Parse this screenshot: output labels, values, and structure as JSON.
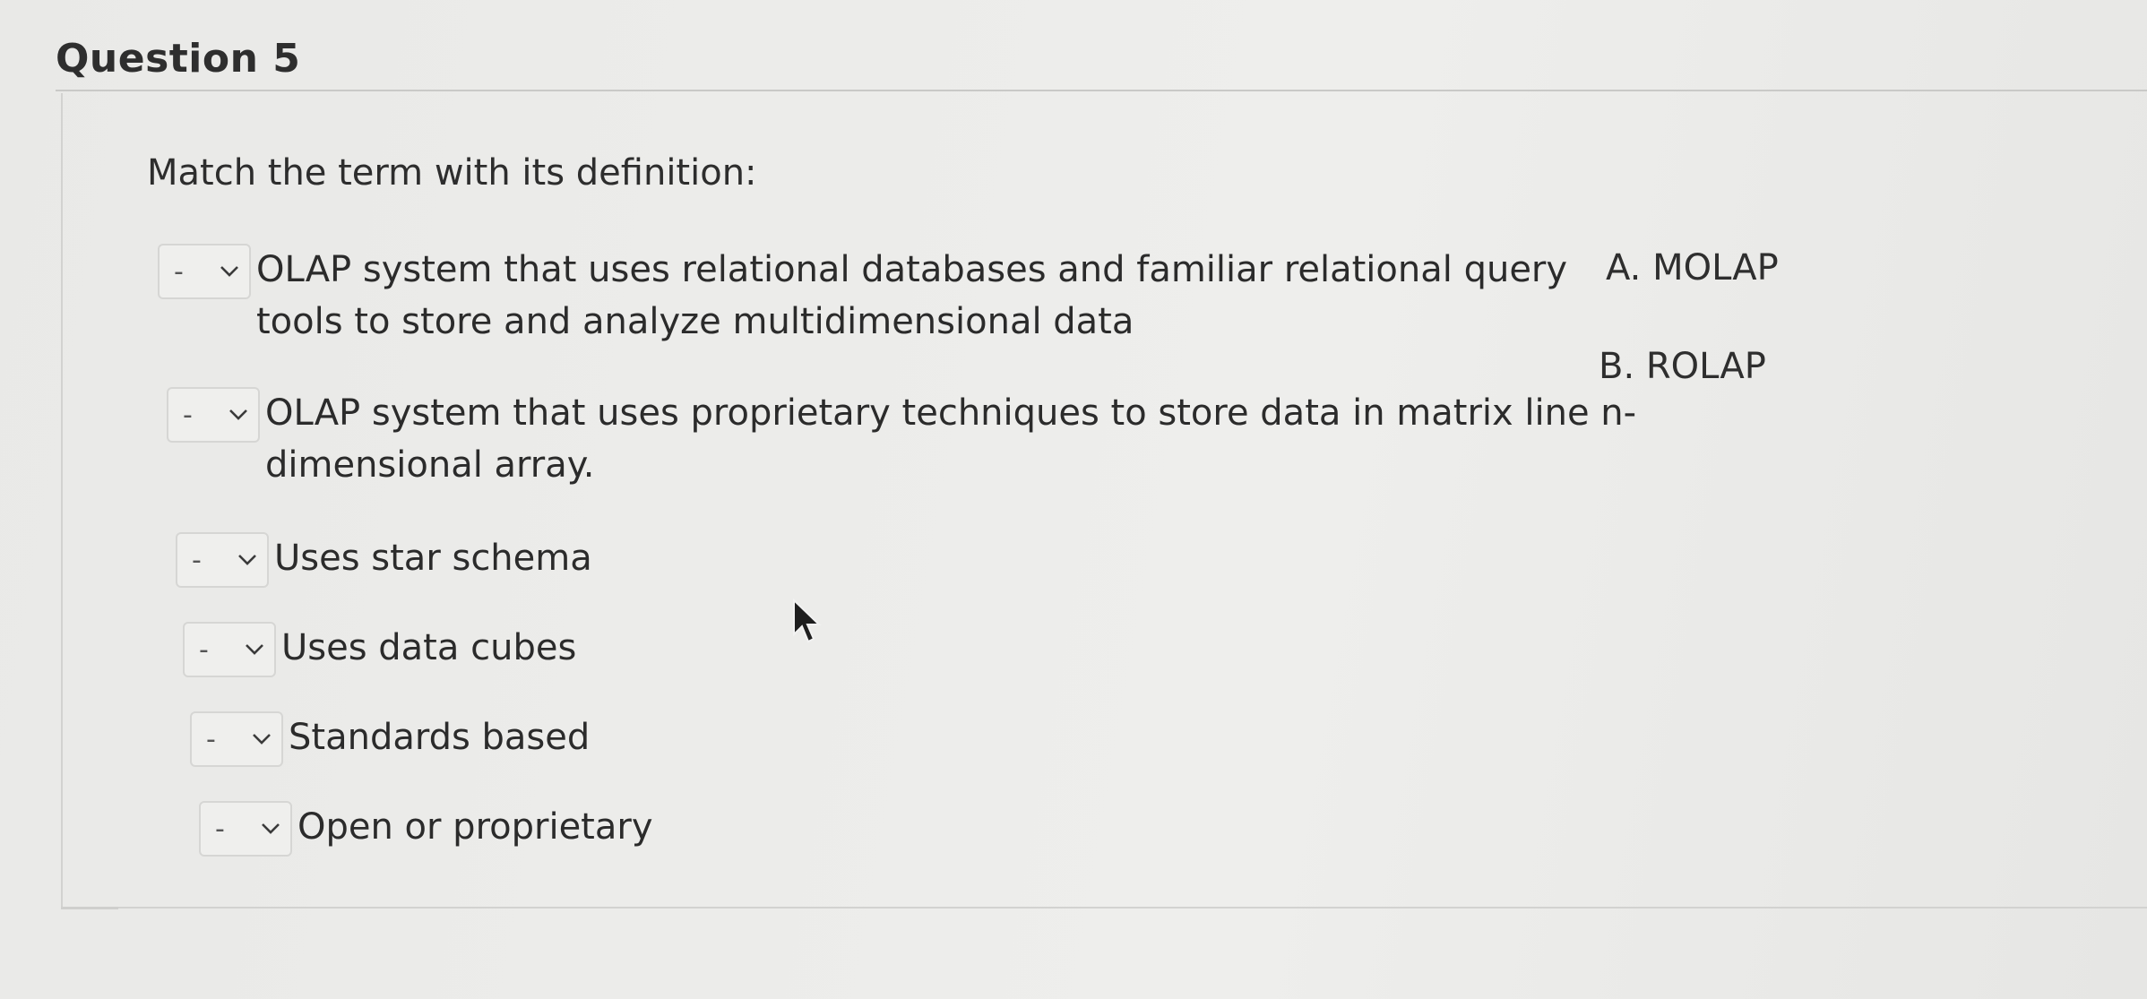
{
  "question": {
    "title": "Question 5",
    "prompt": "Match the term with its definition:"
  },
  "rows": [
    {
      "selected": "-",
      "term_line1": "OLAP system that uses relational databases and familiar relational query",
      "term_line2": "tools to store and analyze multidimensional data"
    },
    {
      "selected": "-",
      "term_line1": "OLAP system that uses proprietary techniques to store data in matrix line n-",
      "term_line2": "dimensional array."
    },
    {
      "selected": "-",
      "term_line1": "Uses star schema"
    },
    {
      "selected": "-",
      "term_line1": "Uses data cubes"
    },
    {
      "selected": "-",
      "term_line1": "Standards based"
    },
    {
      "selected": "-",
      "term_line1": "Open or proprietary"
    }
  ],
  "options": [
    "A. MOLAP",
    "B. ROLAP"
  ],
  "icons": {
    "select_chevron": "chevron-down-icon",
    "pointer": "mouse-cursor-icon"
  }
}
